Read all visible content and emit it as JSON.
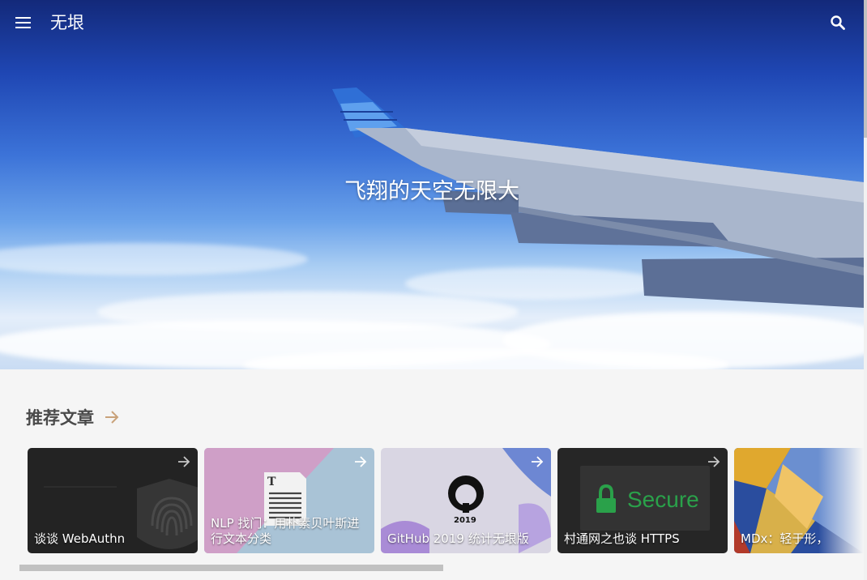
{
  "header": {
    "site_title": "无垠",
    "menu_icon": "menu-icon",
    "search_icon": "search-icon"
  },
  "hero": {
    "slogan": "飞翔的天空无限大"
  },
  "recommended": {
    "title": "推荐文章",
    "arrow_icon": "arrow-right-icon",
    "accent": "#c9a27a",
    "cards": [
      {
        "title": "谈谈 WebAuthn",
        "theme": "fingerprint"
      },
      {
        "title": "NLP 找门：用朴素贝叶斯进行文本分类",
        "theme": "document"
      },
      {
        "title": "GitHub 2019 统计无垠版",
        "theme": "github"
      },
      {
        "title": "村通网之也谈 HTTPS",
        "theme": "secure",
        "badge": "Secure"
      },
      {
        "title": "MDx：轻于形，",
        "theme": "mdx"
      }
    ]
  }
}
